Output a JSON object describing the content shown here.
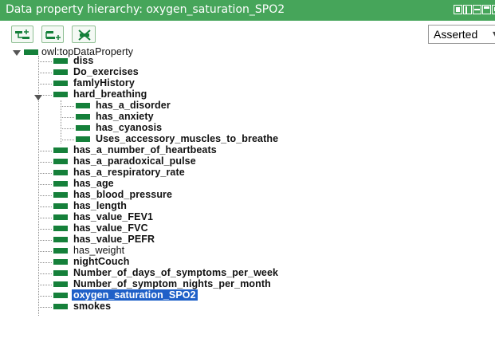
{
  "window": {
    "title": "Data property hierarchy: oxygen_saturation_SPO2"
  },
  "toolbar": {
    "add_subproperty_icon": "add-subproperty-icon",
    "add_sibling_icon": "add-sibling-property-icon",
    "delete_icon": "delete-property-icon",
    "view_mode": "Asserted"
  },
  "colors": {
    "titlebar": "#46a55a",
    "property_bar": "#15803a",
    "selection": "#1f60c8"
  },
  "tree": {
    "root": "owl:topDataProperty",
    "items": [
      "diss",
      "Do_exercises",
      "famlyHistory",
      "hard_breathing",
      "has_a_disorder",
      "has_anxiety",
      "has_cyanosis",
      "Uses_accessory_muscles_to_breathe",
      "has_a_number_of_heartbeats",
      "has_a_paradoxical_pulse",
      "has_a_respiratory_rate",
      "has_age",
      "has_blood_pressure",
      "has_length",
      "has_value_FEV1",
      "has_value_FVC",
      "has_value_PEFR",
      "has_weight",
      "nightCouch",
      "Number_of_days_of_symptoms_per_week",
      "Number_of_symptom_nights_per_month",
      "oxygen_saturation_SPO2",
      "smokes"
    ],
    "selected": "oxygen_saturation_SPO2"
  }
}
